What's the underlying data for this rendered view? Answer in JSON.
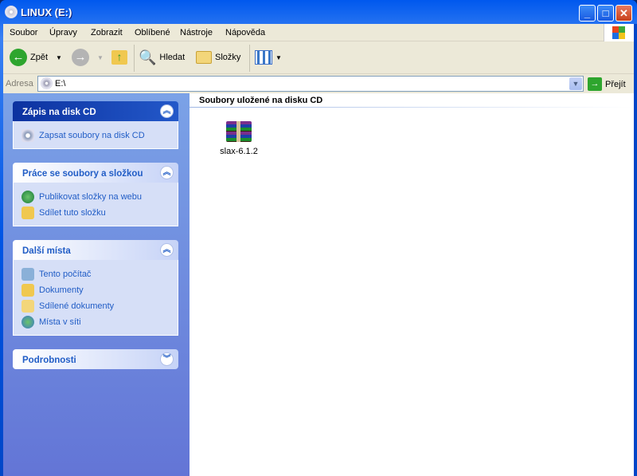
{
  "window": {
    "title": "LINUX (E:)",
    "min": "_",
    "max": "□",
    "close": "✕"
  },
  "menu": [
    "Soubor",
    "Úpravy",
    "Zobrazit",
    "Oblíbené",
    "Nástroje",
    "Nápověda"
  ],
  "toolbar": {
    "back": "Zpět",
    "search": "Hledat",
    "folders": "Složky"
  },
  "address": {
    "label": "Adresa",
    "value": "E:\\",
    "go": "Přejít"
  },
  "panels": [
    {
      "title": "Zápis na disk CD",
      "items": [
        "Zapsat soubory na disk CD"
      ]
    },
    {
      "title": "Práce se soubory a složkou",
      "items": [
        "Publikovat složky na webu",
        "Sdílet tuto složku"
      ]
    },
    {
      "title": "Další místa",
      "items": [
        "Tento počítač",
        "Dokumenty",
        "Sdílené dokumenty",
        "Místa v síti"
      ]
    },
    {
      "title": "Podrobnosti",
      "items": []
    }
  ],
  "content": {
    "group": "Soubory uložené na disku CD",
    "files": [
      {
        "name": "slax-6.1.2"
      }
    ]
  }
}
